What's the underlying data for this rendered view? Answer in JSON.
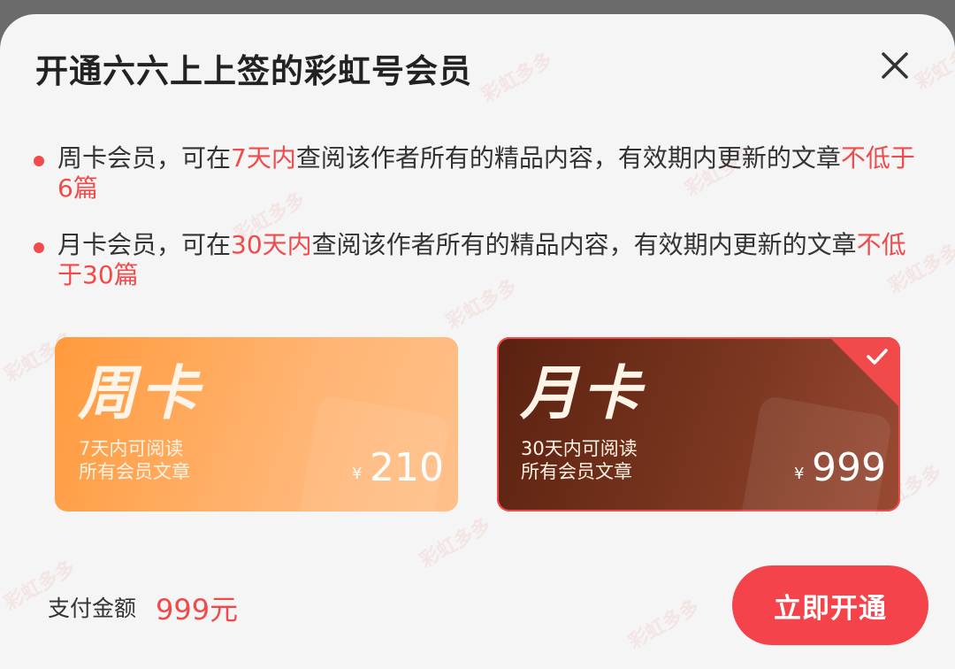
{
  "dialog": {
    "title": "开通六六上上签的彩虹号会员",
    "close_icon": "close-icon"
  },
  "rules": [
    {
      "pre": "周卡会员，可在",
      "hl1": "7天内",
      "mid": "查阅该作者所有的精品内容，有效期内更新的文章",
      "hl2": "不低于6篇"
    },
    {
      "pre": "月卡会员，可在",
      "hl1": "30天内",
      "mid": "查阅该作者所有的精品内容，有效期内更新的文章",
      "hl2": "不低于30篇"
    }
  ],
  "cards": [
    {
      "name": "周卡",
      "desc1": "7天内可阅读",
      "desc2": "所有会员文章",
      "currency": "¥",
      "price": "210",
      "selected": false
    },
    {
      "name": "月卡",
      "desc1": "30天内可阅读",
      "desc2": "所有会员文章",
      "currency": "¥",
      "price": "999",
      "selected": true
    }
  ],
  "footer": {
    "pay_label": "支付金额",
    "pay_amount": "999元",
    "confirm_label": "立即开通"
  },
  "watermark": "彩虹多多",
  "colors": {
    "accent": "#f04a4a",
    "week_card": "#ffa14a",
    "month_card": "#6a2a15",
    "button": "#f4434a"
  }
}
